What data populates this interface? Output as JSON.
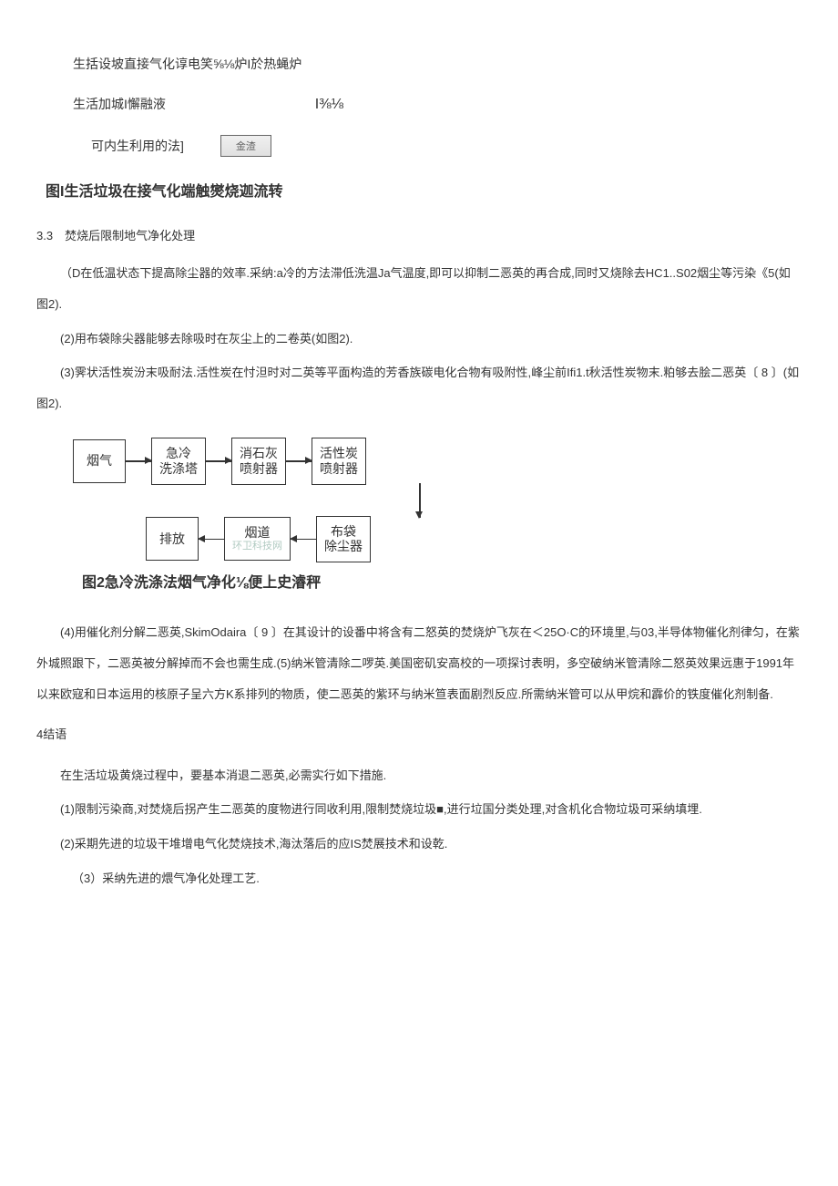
{
  "top": {
    "line1": "生括设坡直接气化谆电笑⅝⅛炉I於热蝇炉",
    "line2_left": "生活加城I懈融液",
    "line2_right": "I⅜⅛",
    "line3_left": "可内生利用的法]",
    "line3_box": "金渣"
  },
  "fig1_caption": "图I生活垃圾在接气化端触爕烧迦流转",
  "sec33_head": "3.3　焚烧后限制地气净化处理",
  "p1": "（D在低温状态下提高除尘器的效率.采纳:a冷的方法滞低洗温Ja气温度,即可以抑制二恶英的再合成,同时又烧除去HC1..S02烟尘等污染《5(如图2).",
  "p2": "(2)用布袋除尖器能够去除吸时在灰尘上的二卷英(如图2).",
  "p3": "(3)霁状活性炭汾末吸耐法.活性炭在忖泹时对二英等平面构造的芳香族碳电化合物有吸附性,峰尘前Ifi1.t秋活性炭物末.粕够去脍二恶英〔 8 〕(如图2).",
  "diagram2": {
    "r1b1": "烟气",
    "r1b2a": "急冷",
    "r1b2b": "洗涤塔",
    "r1b3a": "消石灰",
    "r1b3b": "喷射器",
    "r1b4a": "活性炭",
    "r1b4b": "喷射器",
    "r2b1": "排放",
    "r2b2": "烟道",
    "r2b3a": "布袋",
    "r2b3b": "除尘器",
    "wm": "环卫科技网"
  },
  "fig2_caption": "图2急冷洗涤法烟气净化⅛便上史濬秤",
  "p4": "(4)用催化剂分解二恶英,SkimOdaira〔 9 〕在其设计的设番中将含有二怒英的焚烧炉飞灰在＜25O·C的环境里,与03,半导体物催化剂律匀，在紫外城照跟下，二恶英被分解掉而不会也需生成.(5)纳米管清除二啰英.美国密矶安高校的一项探讨表明，多空破纳米管清除二怒英效果远惠于1991年以来欧寇和日本运用的核原子呈六方K系排列的物质，使二恶英的紫环与纳米笪表面剧烈反应.所需纳米管可以从甲烷和霹价的铁度催化剂制备.",
  "sec4_head": "4结语",
  "p5": "在生活垃圾黄烧过程中，要基本消退二恶英,必需实行如下措施.",
  "p6": "(1)限制污染商,对焚烧后拐产生二恶英的度物进行同收利用,限制焚烧垃圾■,进行垃国分类处理,对含机化合物垃圾可采纳填埋.",
  "p7": "(2)采期先进的垃圾干堆增电气化焚烧技术,海汰落后的应IS焚展技术和设乾.",
  "p8": "（3）采纳先进的煨气净化处理工艺."
}
